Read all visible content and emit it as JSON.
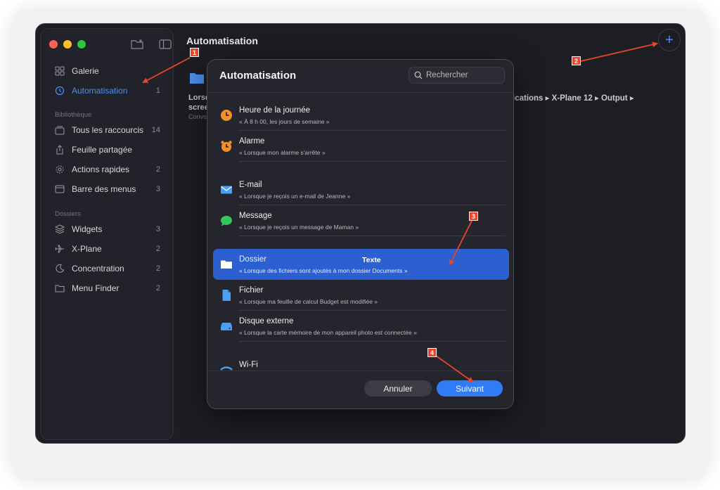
{
  "sidebar": {
    "items": [
      {
        "label": "Galerie",
        "count": "",
        "icon": "grid-icon"
      },
      {
        "label": "Automatisation",
        "count": "1",
        "icon": "clock-check-icon"
      },
      {
        "label": "Tous les raccourcis",
        "count": "14",
        "icon": "stack-icon"
      },
      {
        "label": "Feuille partagée",
        "count": "",
        "icon": "share-icon"
      },
      {
        "label": "Actions rapides",
        "count": "2",
        "icon": "gear-icon"
      },
      {
        "label": "Barre des menus",
        "count": "3",
        "icon": "window-icon"
      },
      {
        "label": "Widgets",
        "count": "3",
        "icon": "layers-icon"
      },
      {
        "label": "X-Plane",
        "count": "2",
        "icon": "airplane-icon"
      },
      {
        "label": "Concentration",
        "count": "2",
        "icon": "moon-icon"
      },
      {
        "label": "Menu Finder",
        "count": "2",
        "icon": "folder-icon"
      }
    ],
    "section_library": "Bibliothèque",
    "section_folders": "Dossiers"
  },
  "main": {
    "title": "Automatisation",
    "bg_card_title": "Lorsq\nscree",
    "bg_card_sub": "Conve",
    "bg_path": "ications ▸ X-Plane 12 ▸ Output ▸"
  },
  "modal": {
    "title": "Automatisation",
    "search_placeholder": "Rechercher",
    "items": [
      {
        "title": "Heure de la journée",
        "subtitle": "« À 8 h 00, les jours de semaine »",
        "icon": "clock-icon"
      },
      {
        "title": "Alarme",
        "subtitle": "« Lorsque mon alarme s'arrête »",
        "icon": "alarm-icon"
      },
      {
        "title": "E-mail",
        "subtitle": "« Lorsque je reçois un e-mail de Jeanne »",
        "icon": "mail-icon"
      },
      {
        "title": "Message",
        "subtitle": "« Lorsque je reçois un message de Maman »",
        "icon": "message-icon"
      },
      {
        "title": "Dossier",
        "subtitle": "« Lorsque des fichiers sont ajoutés à mon dossier Documents »",
        "icon": "folder-icon",
        "tag": "Texte"
      },
      {
        "title": "Fichier",
        "subtitle": "« Lorsque ma feuille de calcul Budget est modifiée »",
        "icon": "file-icon"
      },
      {
        "title": "Disque externe",
        "subtitle": "« Lorsque la carte mémoire de mon appareil photo est connectée »",
        "icon": "drive-icon"
      },
      {
        "title": "Wi-Fi",
        "subtitle": "",
        "icon": "wifi-icon"
      }
    ],
    "cancel_label": "Annuler",
    "next_label": "Suivant"
  },
  "annotations": [
    "1",
    "2",
    "3",
    "4"
  ],
  "colors": {
    "accent": "#2f7cf6",
    "selected_row": "#2c5fd0",
    "annotation": "#e8452c"
  }
}
